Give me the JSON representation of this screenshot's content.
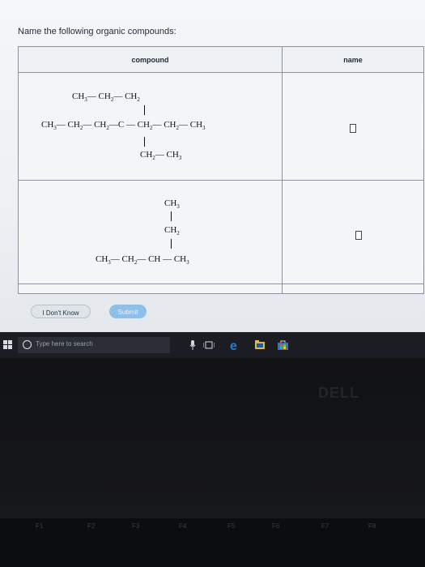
{
  "instruction": "Name the following organic compounds:",
  "table": {
    "header_compound": "compound",
    "header_name": "name"
  },
  "compound1": {
    "top_line": "CH3— CH2— CH2",
    "main_line": "CH3— CH2— CH2—C — CH2— CH2— CH3",
    "bottom_line": "CH2— CH3"
  },
  "compound2": {
    "line1": "CH3",
    "line2": "CH2",
    "line3": "CH3— CH2— CH — CH3"
  },
  "buttons": {
    "dont_know": "I Don't Know",
    "submit": "Submit"
  },
  "taskbar": {
    "search_placeholder": "Type here to search"
  },
  "laptop": {
    "brand": "DELL",
    "fkeys": [
      "F1",
      "F2",
      "F3",
      "F4",
      "F5",
      "F6",
      "F7",
      "F8"
    ]
  },
  "colors": {
    "taskbar": "#1b1d22",
    "edge_blue": "#1f7fd6",
    "store_blue": "#2b78c8",
    "store_yellow": "#f2c230"
  }
}
